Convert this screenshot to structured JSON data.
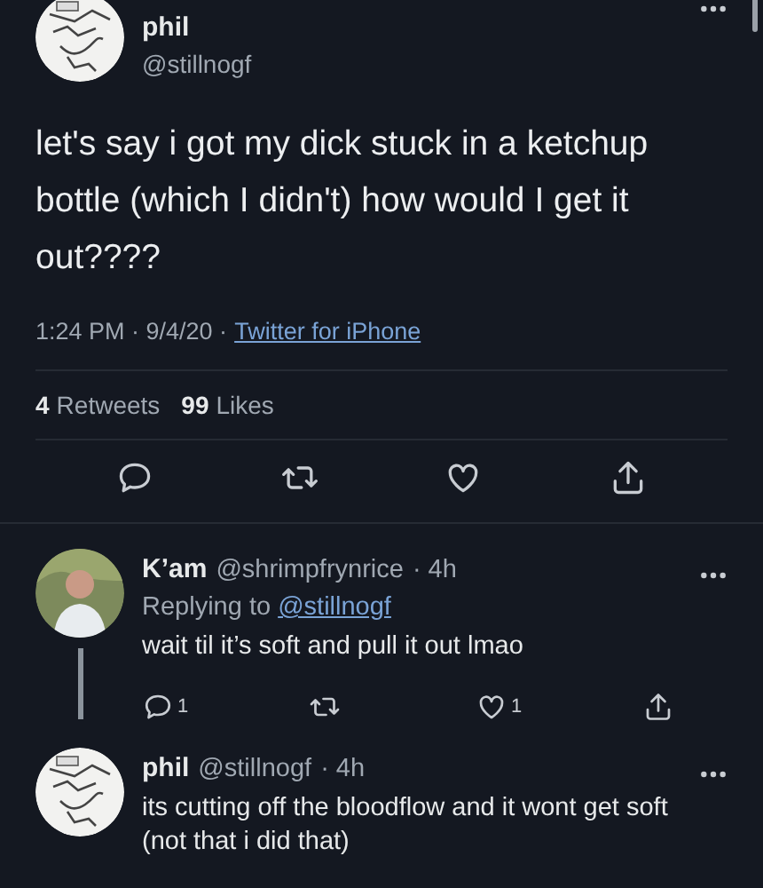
{
  "tweet": {
    "author": {
      "name": "phil",
      "handle": "@stillnogf"
    },
    "text": "let's say i got my dick stuck in a ketchup bottle (which I didn't) how would I get it out????",
    "timestamp": "1:24 PM · 9/4/20 ·",
    "source": "Twitter for iPhone",
    "stats": [
      {
        "count": "4",
        "label": "Retweets"
      },
      {
        "count": "99",
        "label": "Likes"
      }
    ],
    "actions": [
      {
        "kind": "reply"
      },
      {
        "kind": "retweet"
      },
      {
        "kind": "like"
      },
      {
        "kind": "share"
      }
    ]
  },
  "replies": [
    {
      "name": "K’am",
      "handle": "@shrimpfrynrice",
      "time": "· 4h",
      "replying_label": "Replying to",
      "replying_handle": "@stillnogf",
      "text": "wait til it’s soft and pull it out lmao",
      "thread": true,
      "actions": [
        {
          "kind": "reply",
          "count": "1"
        },
        {
          "kind": "retweet"
        },
        {
          "kind": "like",
          "count": "1"
        },
        {
          "kind": "share"
        }
      ]
    },
    {
      "name": "phil",
      "handle": "@stillnogf",
      "time": "· 4h",
      "text": "its cutting off the bloodflow and it wont get soft (not that i did that)",
      "thread": false
    }
  ]
}
